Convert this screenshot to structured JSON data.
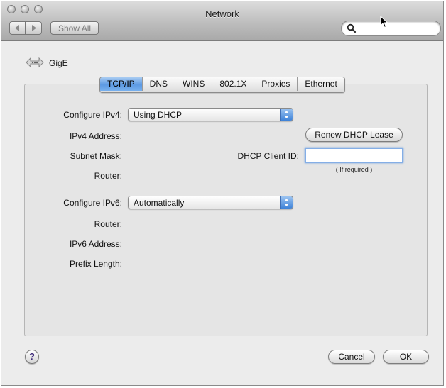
{
  "window": {
    "title": "Network",
    "traffic_lights": [
      "close-icon",
      "minimize-icon",
      "zoom-icon"
    ]
  },
  "toolbar": {
    "back_icon": "back-arrow-icon",
    "forward_icon": "forward-arrow-icon",
    "show_all_label": "Show All",
    "search_value": "",
    "search_icon": "magnifier-icon"
  },
  "device": {
    "icon": "ethernet-arrows-icon",
    "name": "GigE"
  },
  "tabs": [
    {
      "label": "TCP/IP",
      "active": true
    },
    {
      "label": "DNS",
      "active": false
    },
    {
      "label": "WINS",
      "active": false
    },
    {
      "label": "802.1X",
      "active": false
    },
    {
      "label": "Proxies",
      "active": false
    },
    {
      "label": "Ethernet",
      "active": false
    }
  ],
  "tcpip": {
    "configure_ipv4_label": "Configure IPv4:",
    "configure_ipv4_value": "Using DHCP",
    "ipv4_address_label": "IPv4 Address:",
    "subnet_mask_label": "Subnet Mask:",
    "router_label": "Router:",
    "renew_button": "Renew DHCP Lease",
    "dhcp_client_id_label": "DHCP Client ID:",
    "dhcp_client_id_value": "",
    "dhcp_hint": "( If required )",
    "configure_ipv6_label": "Configure IPv6:",
    "configure_ipv6_value": "Automatically",
    "ipv6_router_label": "Router:",
    "ipv6_address_label": "IPv6 Address:",
    "prefix_length_label": "Prefix Length:"
  },
  "footer": {
    "help_label": "?",
    "cancel_label": "Cancel",
    "ok_label": "OK"
  },
  "colors": {
    "accent": "#5d9ae3",
    "focus_ring": "#84aee6"
  }
}
